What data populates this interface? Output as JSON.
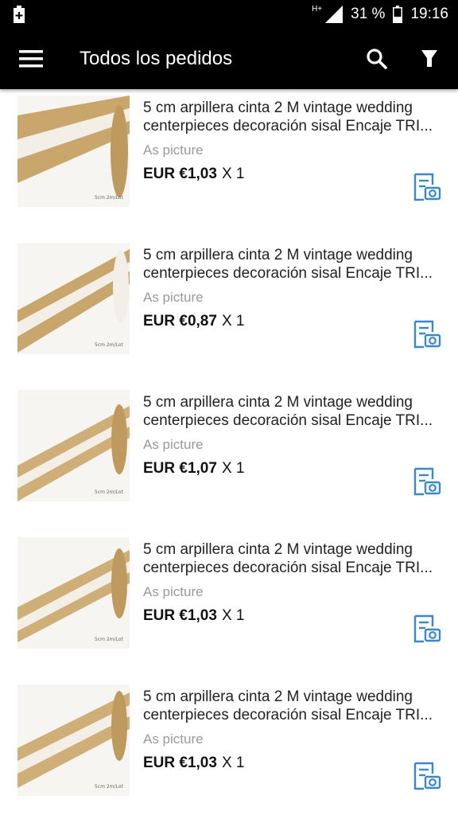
{
  "status_bar": {
    "network": "H+",
    "battery_percent": "31 %",
    "time": "19:16"
  },
  "app_bar": {
    "title": "Todos los pedidos",
    "icons": [
      "menu-icon",
      "search-icon",
      "filter-icon"
    ]
  },
  "orders": [
    {
      "title": "5 cm arpillera cinta 2 M vintage wedding centerpieces decoración sisal Encaje TRI...",
      "variant": "As picture",
      "price": "EUR €1,03",
      "quantity": "X 1",
      "thumb_caption": "5cm 2m/Lot"
    },
    {
      "title": "5 cm arpillera cinta 2 M vintage wedding centerpieces decoración sisal Encaje TRI...",
      "variant": "As picture",
      "price": "EUR €0,87",
      "quantity": "X 1",
      "thumb_caption": "5cm 2m/Lot"
    },
    {
      "title": "5 cm arpillera cinta 2 M vintage wedding centerpieces decoración sisal Encaje TRI...",
      "variant": "As picture",
      "price": "EUR €1,07",
      "quantity": "X 1",
      "thumb_caption": "5cm 2m/Lot"
    },
    {
      "title": "5 cm arpillera cinta 2 M vintage wedding centerpieces decoración sisal Encaje TRI...",
      "variant": "As picture",
      "price": "EUR €1,03",
      "quantity": "X 1",
      "thumb_caption": "5cm 2m/Lot"
    },
    {
      "title": "5 cm arpillera cinta 2 M vintage wedding centerpieces decoración sisal Encaje TRI...",
      "variant": "As picture",
      "price": "EUR €1,03",
      "quantity": "X 1",
      "thumb_caption": "5cm 2m/Lot"
    }
  ],
  "colors": {
    "app_bar": "#000000",
    "accent_icon": "#3a87c9",
    "burlap": "#c9a66b",
    "lace": "#f4f1ea"
  }
}
